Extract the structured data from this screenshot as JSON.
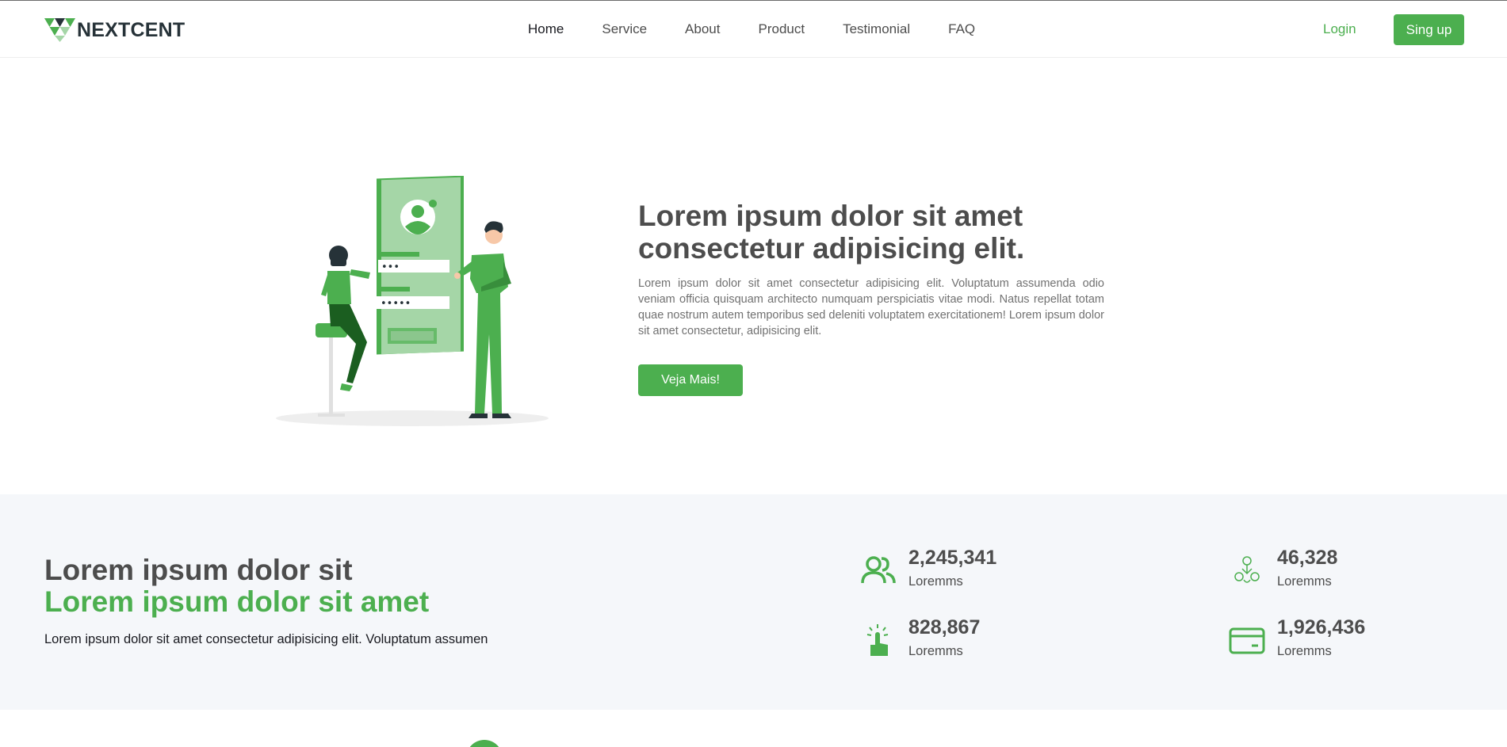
{
  "brand": {
    "name": "NEXTCENT",
    "color": "#4CAF4F"
  },
  "nav": {
    "items": [
      {
        "label": "Home",
        "active": true
      },
      {
        "label": "Service",
        "active": false
      },
      {
        "label": "About",
        "active": false
      },
      {
        "label": "Product",
        "active": false
      },
      {
        "label": "Testimonial",
        "active": false
      },
      {
        "label": "FAQ",
        "active": false
      }
    ],
    "login_label": "Login",
    "signup_label": "Sing up"
  },
  "hero": {
    "title": "Lorem ipsum dolor sit amet consectetur adipisicing elit.",
    "text": "Lorem ipsum dolor sit amet consectetur adipisicing elit. Voluptatum assumenda odio veniam officia quisquam architecto numquam perspiciatis vitae modi. Natus repellat totam quae nostrum autem temporibus sed deleniti voluptatem exercitationem! Lorem ipsum dolor sit amet consectetur, adipisicing elit.",
    "button_label": "Veja Mais!",
    "illustration": "login-illustration",
    "password_dots_1": "•••",
    "password_dots_2": "•••••"
  },
  "stats_section": {
    "title_line1": "Lorem ipsum dolor sit",
    "title_line2": "Lorem ipsum dolor sit amet",
    "text": "Lorem ipsum dolor sit amet consectetur adipisicing elit. Voluptatum assumen",
    "items": [
      {
        "number": "2,245,341",
        "label": "Loremms",
        "icon": "users-icon"
      },
      {
        "number": "46,328",
        "label": "Loremms",
        "icon": "hands-icon"
      },
      {
        "number": "828,867",
        "label": "Loremms",
        "icon": "click-icon"
      },
      {
        "number": "1,926,436",
        "label": "Loremms",
        "icon": "card-icon"
      }
    ]
  }
}
